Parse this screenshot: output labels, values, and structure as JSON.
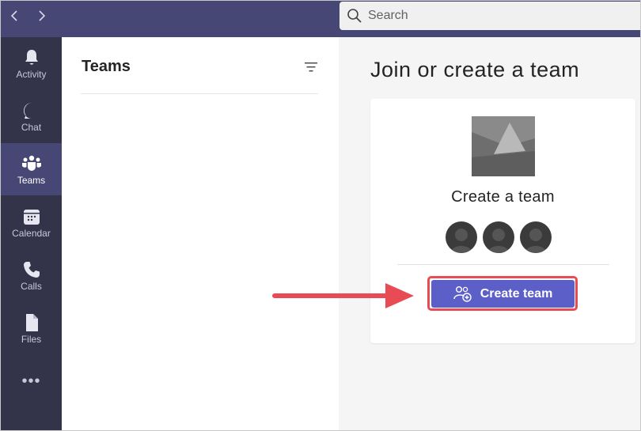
{
  "search": {
    "placeholder": "Search"
  },
  "rail": {
    "items": [
      {
        "label": "Activity",
        "icon": "bell-icon"
      },
      {
        "label": "Chat",
        "icon": "chat-icon"
      },
      {
        "label": "Teams",
        "icon": "teams-icon",
        "active": true
      },
      {
        "label": "Calendar",
        "icon": "calendar-icon"
      },
      {
        "label": "Calls",
        "icon": "phone-icon"
      },
      {
        "label": "Files",
        "icon": "file-icon"
      }
    ],
    "more": "•••"
  },
  "teams_panel": {
    "title": "Teams"
  },
  "main": {
    "title": "Join or create a team",
    "card": {
      "title": "Create a team",
      "button_label": "Create team"
    }
  },
  "colors": {
    "topbar": "#464775",
    "rail": "#33344a",
    "accent": "#5b5fc7",
    "highlight": "#e84b53"
  }
}
